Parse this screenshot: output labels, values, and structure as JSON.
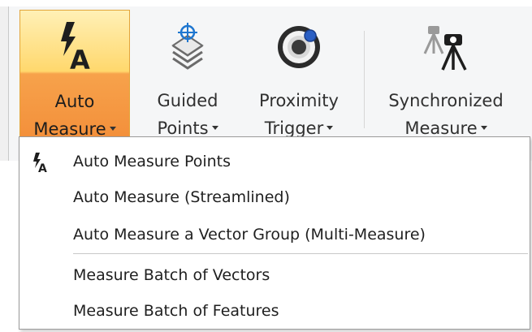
{
  "ribbon": {
    "buttons": [
      {
        "line1": "Auto",
        "line2": "Measure",
        "icon": "auto-measure-icon",
        "active": true
      },
      {
        "line1": "Guided",
        "line2": "Points",
        "icon": "guided-points-icon",
        "active": false
      },
      {
        "line1": "Proximity",
        "line2": "Trigger",
        "icon": "proximity-trigger-icon",
        "active": false
      },
      {
        "line1": "Synchronized",
        "line2": "Measure",
        "icon": "synchronized-measure-icon",
        "active": false
      }
    ]
  },
  "menu": {
    "items": [
      {
        "label": "Auto Measure Points",
        "icon": "auto-measure-icon"
      },
      {
        "label": "Auto Measure (Streamlined)"
      },
      {
        "label": "Auto Measure a Vector Group (Multi-Measure)"
      },
      {
        "label": "Measure Batch of Vectors"
      },
      {
        "label": "Measure Batch of Features"
      }
    ]
  },
  "colors": {
    "active_top": "#fff0b6",
    "active_bottom": "#f3903b",
    "accent_blue": "#1f77d0"
  }
}
